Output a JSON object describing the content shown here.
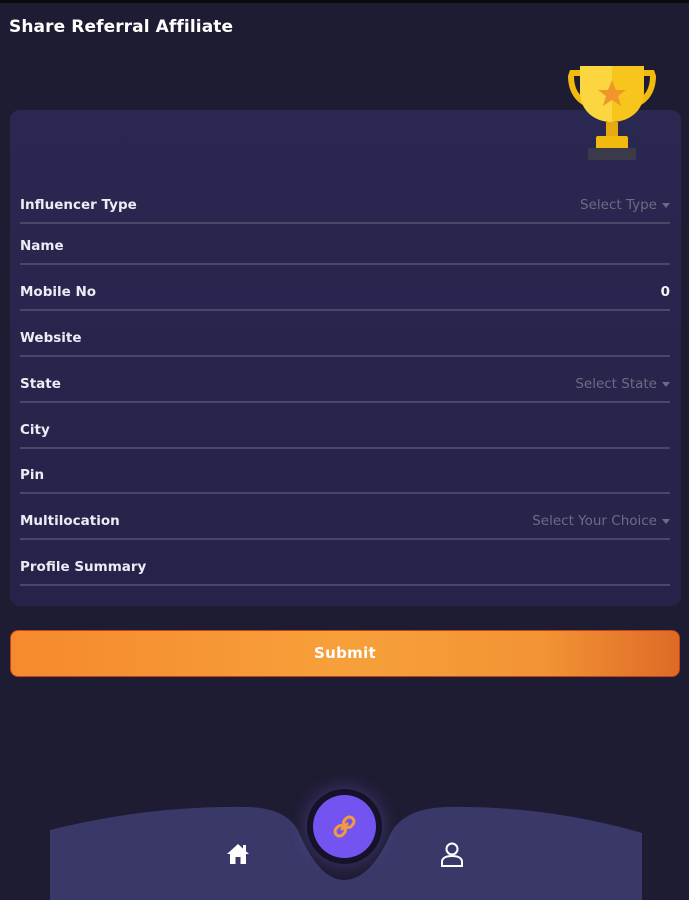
{
  "header": {
    "title": "Share Referral Affiliate"
  },
  "form": {
    "fields": [
      {
        "label": "Influencer Type",
        "value": "Select Type",
        "kind": "dropdown"
      },
      {
        "label": "Name",
        "value": "",
        "kind": "text"
      },
      {
        "label": "Mobile No",
        "value": "0",
        "kind": "number"
      },
      {
        "label": "Website",
        "value": "",
        "kind": "text"
      },
      {
        "label": "State",
        "value": "Select State",
        "kind": "dropdown"
      },
      {
        "label": "City",
        "value": "",
        "kind": "text"
      },
      {
        "label": "Pin",
        "value": "",
        "kind": "text"
      },
      {
        "label": "Multilocation",
        "value": "Select Your Choice",
        "kind": "dropdown"
      },
      {
        "label": "Profile Summary",
        "value": "",
        "kind": "text"
      }
    ],
    "submit_label": "Submit"
  },
  "nav": {
    "items": [
      {
        "icon": "home-icon"
      },
      {
        "icon": "link-icon",
        "active": true
      },
      {
        "icon": "user-icon"
      }
    ]
  },
  "colors": {
    "background": "#1e1c32",
    "card": "#2a2750",
    "accent_orange": "#f7a03a",
    "fab_purple": "#7354f0",
    "nav_bar": "#3a3868"
  }
}
